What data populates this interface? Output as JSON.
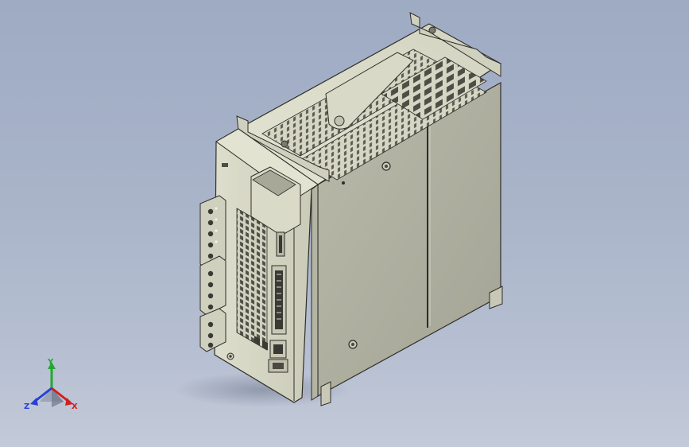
{
  "viewport": {
    "background_top": "#9eabc3",
    "background_bottom": "#c3cad9"
  },
  "model": {
    "body_color": "#d8d8c6",
    "shade_color": "#9e9e91",
    "edge_color": "#2e2e28"
  },
  "triad": {
    "x_label": "X",
    "y_label": "Y",
    "z_label": "Z",
    "x_color": "#d21f1f",
    "y_color": "#22a82e",
    "z_color": "#2a3fd6"
  }
}
